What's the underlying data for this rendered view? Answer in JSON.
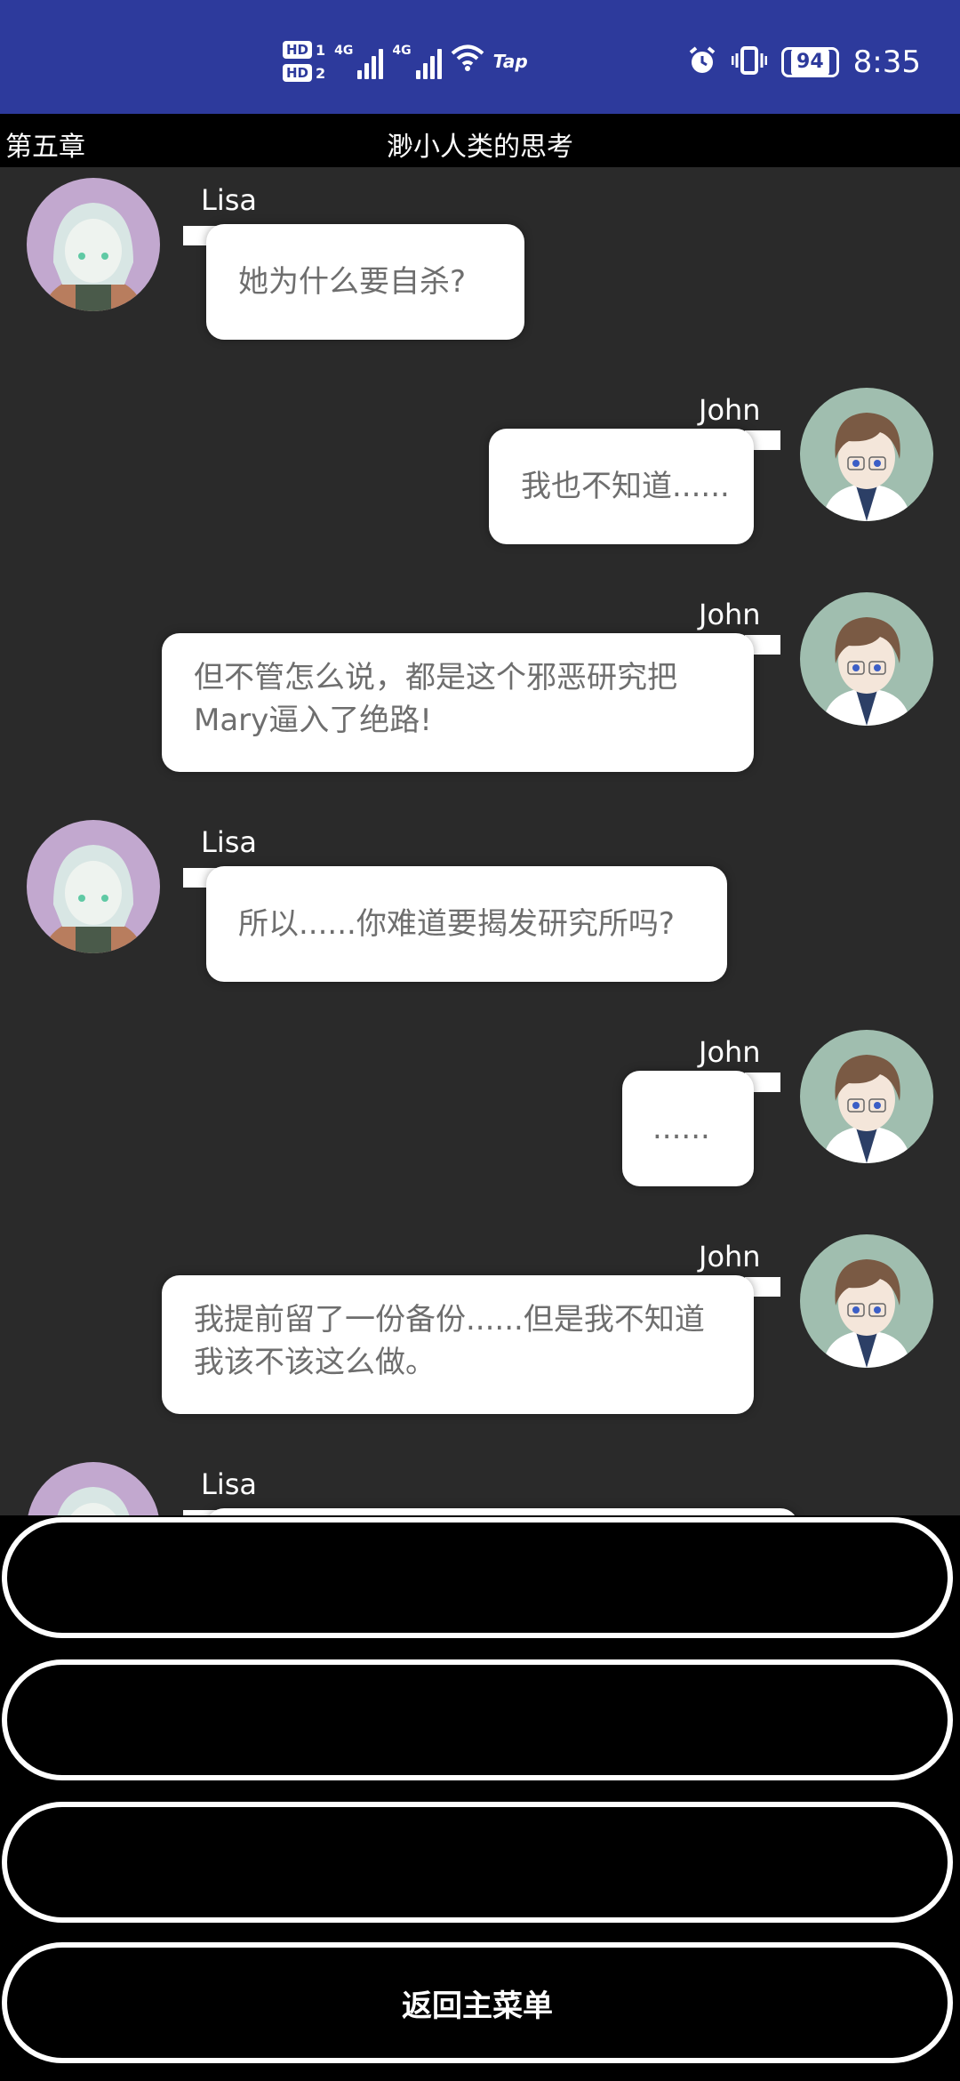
{
  "status_bar": {
    "hd1": "HD",
    "sim1": "1",
    "hd2": "HD",
    "sim2": "2",
    "net1": "4G",
    "net2": "4G",
    "tap": "Tap",
    "battery": "94",
    "time": "8:35"
  },
  "header": {
    "chapter": "第五章",
    "title": "渺小人类的思考"
  },
  "messages": [
    {
      "speaker": "Lisa",
      "text": "她为什么要自杀?"
    },
    {
      "speaker": "John",
      "text": "我也不知道......"
    },
    {
      "speaker": "John",
      "text": "但不管怎么说，都是这个邪恶研究把Mary逼入了绝路!"
    },
    {
      "speaker": "Lisa",
      "text": "所以......你难道要揭发研究所吗?"
    },
    {
      "speaker": "John",
      "text": "......"
    },
    {
      "speaker": "John",
      "text": "我提前留了一份备份......但是我不知道我该不该这么做。"
    },
    {
      "speaker": "Lisa",
      "text": ""
    }
  ],
  "options": {
    "option1": "",
    "option2": "",
    "option3": "",
    "menu": "返回主菜单"
  }
}
